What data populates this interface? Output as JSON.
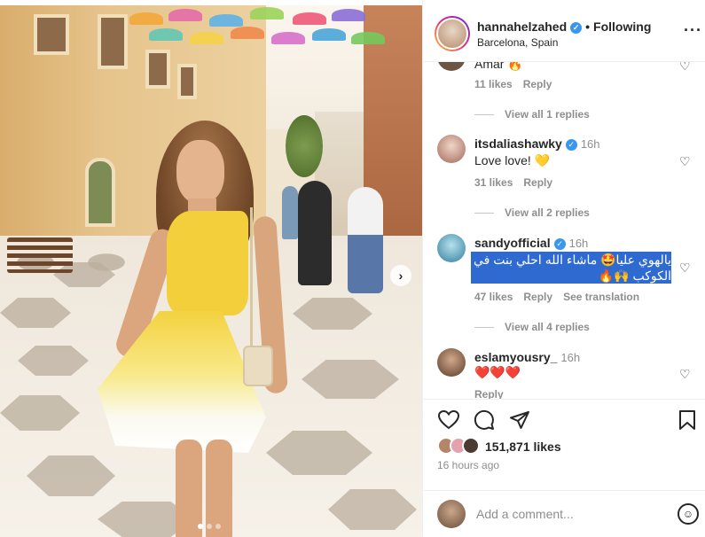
{
  "post": {
    "username": "hannahelzahed",
    "follow_status": "Following",
    "separator": "•",
    "location": "Barcelona, Spain",
    "more_icon": "more-horizontal-icon"
  },
  "comments": [
    {
      "text": "Amar 🔥",
      "likes": "11 likes",
      "reply": "Reply",
      "view_replies": "View all 1 replies"
    },
    {
      "username": "itsdaliashawky",
      "time": "16h",
      "text": "Love love! 💛",
      "likes": "31 likes",
      "reply": "Reply",
      "view_replies": "View all 2 replies"
    },
    {
      "username": "sandyofficial",
      "time": "16h",
      "text": "يالهوي عليا🤩 ماشاء الله احلي بنت في الكوكب 🙌🔥",
      "likes": "47 likes",
      "reply": "Reply",
      "translate": "See translation",
      "view_replies": "View all 4 replies"
    },
    {
      "username": "eslamyousry_",
      "time": "16h",
      "text": "❤️❤️❤️",
      "reply": "Reply"
    }
  ],
  "actions": {
    "likes": "151,871 likes",
    "posted": "16 hours ago"
  },
  "add_comment": {
    "placeholder": "Add a comment..."
  },
  "carousel": {
    "slide_count": 3,
    "active_slide": 1,
    "next_label": "›"
  },
  "colors": {
    "verified": "#3897f0",
    "highlight": "#2f6ad0",
    "muted": "#8e8e8e",
    "text": "#262626"
  }
}
